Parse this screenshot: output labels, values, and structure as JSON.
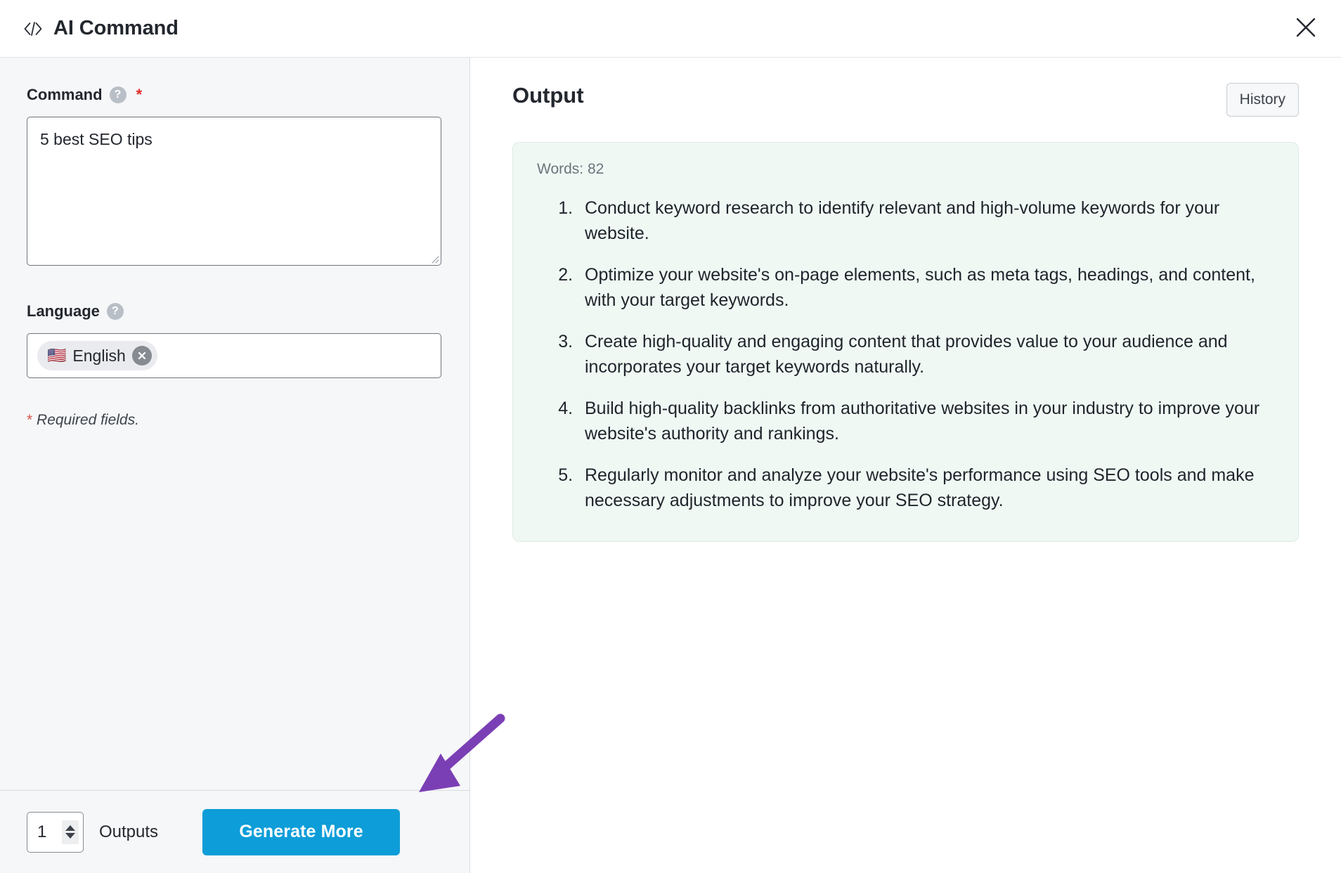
{
  "window": {
    "title": "AI Command",
    "code_icon": "code-icon",
    "close_icon": "close-icon"
  },
  "form": {
    "command": {
      "label": "Command",
      "help_icon": "help-circle-icon",
      "required_marker": "*",
      "value": "5 best SEO tips"
    },
    "language": {
      "label": "Language",
      "help_icon": "help-circle-icon",
      "chip": {
        "flag": "🇺🇸",
        "label": "English",
        "remove_icon": "close-circle-icon"
      }
    },
    "required_note": {
      "star": "*",
      "text": " Required fields."
    }
  },
  "footer": {
    "outputs_count": "1",
    "outputs_label": "Outputs",
    "generate_label": "Generate More",
    "spinner_up_icon": "chevron-up-icon",
    "spinner_down_icon": "chevron-down-icon"
  },
  "output": {
    "title": "Output",
    "history_label": "History",
    "word_count": "Words: 82",
    "items": [
      "Conduct keyword research to identify relevant and high-volume keywords for your website.",
      "Optimize your website's on-page elements, such as meta tags, headings, and content, with your target keywords.",
      "Create high-quality and engaging content that provides value to your audience and incorporates your target keywords naturally.",
      "Build high-quality backlinks from authoritative websites in your industry to improve your website's authority and rankings.",
      "Regularly monitor and analyze your website's performance using SEO tools and make necessary adjustments to improve your SEO strategy."
    ]
  },
  "annotation": {
    "arrow_color": "#7b3fb5",
    "target": "generate-more-button"
  },
  "colors": {
    "accent_blue": "#0d9dd8",
    "left_panel_bg": "#f6f7f9",
    "output_card_bg": "#f0f8f4",
    "required_red": "#e02b2b",
    "annotation_purple": "#7b3fb5"
  }
}
